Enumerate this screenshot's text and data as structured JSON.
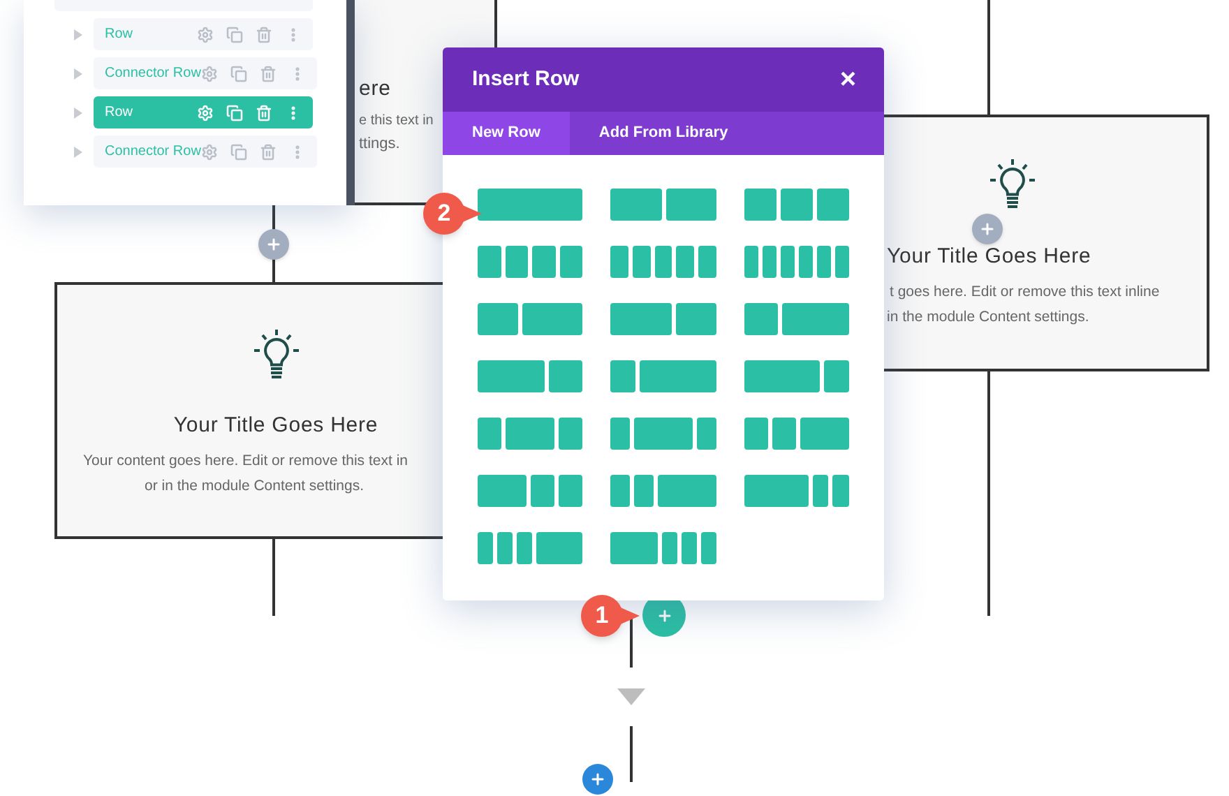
{
  "layers_panel": {
    "items": [
      {
        "label": "Row",
        "selected": false
      },
      {
        "label": "Connector Row",
        "selected": false
      },
      {
        "label": "Row",
        "selected": true
      },
      {
        "label": "Connector Row",
        "selected": false
      }
    ]
  },
  "covered_card": {
    "lines": [
      "ere",
      "e this text in",
      "ttings."
    ]
  },
  "left_card": {
    "title": "Your Title Goes Here",
    "body": [
      "Your content goes here. Edit or remove this text in",
      "or in the module Content settings."
    ]
  },
  "right_card": {
    "title": "Your Title Goes Here",
    "body": [
      "t goes here. Edit or remove this text inline",
      "in the module Content settings."
    ]
  },
  "modal": {
    "title": "Insert Row",
    "close": "×",
    "tabs": [
      {
        "label": "New Row",
        "selected": true
      },
      {
        "label": "Add From Library",
        "selected": false
      }
    ]
  },
  "callouts": [
    "2",
    "1"
  ]
}
